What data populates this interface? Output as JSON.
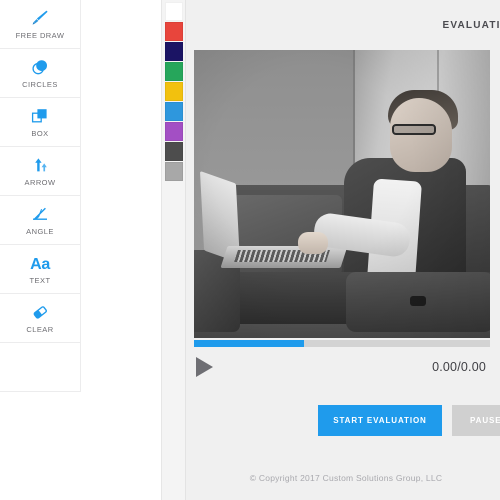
{
  "tools": [
    {
      "id": "free-draw",
      "label": "FREE DRAW",
      "icon": "brush-icon"
    },
    {
      "id": "circles",
      "label": "CIRCLES",
      "icon": "circles-icon"
    },
    {
      "id": "box",
      "label": "BOX",
      "icon": "box-icon"
    },
    {
      "id": "arrow",
      "label": "ARROW",
      "icon": "arrow-icon"
    },
    {
      "id": "angle",
      "label": "ANGLE",
      "icon": "angle-icon"
    },
    {
      "id": "text",
      "label": "TEXT",
      "icon": "text-aa-icon",
      "glyph": "Aa"
    },
    {
      "id": "clear",
      "label": "CLEAR",
      "icon": "eraser-icon"
    }
  ],
  "palette": {
    "colors": [
      {
        "name": "white",
        "hex": "#ffffff"
      },
      {
        "name": "red",
        "hex": "#e8453c"
      },
      {
        "name": "navy",
        "hex": "#1b1464"
      },
      {
        "name": "green",
        "hex": "#26a65b"
      },
      {
        "name": "yellow",
        "hex": "#f2c10e"
      },
      {
        "name": "blue",
        "hex": "#2e97dd"
      },
      {
        "name": "purple",
        "hex": "#a34fc4"
      },
      {
        "name": "dark-gray",
        "hex": "#4d4d4d"
      },
      {
        "name": "light-gray",
        "hex": "#a8a8a8"
      }
    ]
  },
  "header": {
    "title": "EVALUATION"
  },
  "player": {
    "progress_percent": 37,
    "time_display": "0.00/0.00",
    "play_label": "play"
  },
  "actions": {
    "primary_label": "START EVALUATION",
    "secondary_label": "PAUSE"
  },
  "footer": {
    "copyright": "© Copyright 2017 Custom Solutions Group, LLC"
  },
  "colors": {
    "accent": "#1f9bec",
    "panel_bg": "#ffffff",
    "main_bg": "#f0f0f0",
    "label_text": "#6e6e73"
  }
}
